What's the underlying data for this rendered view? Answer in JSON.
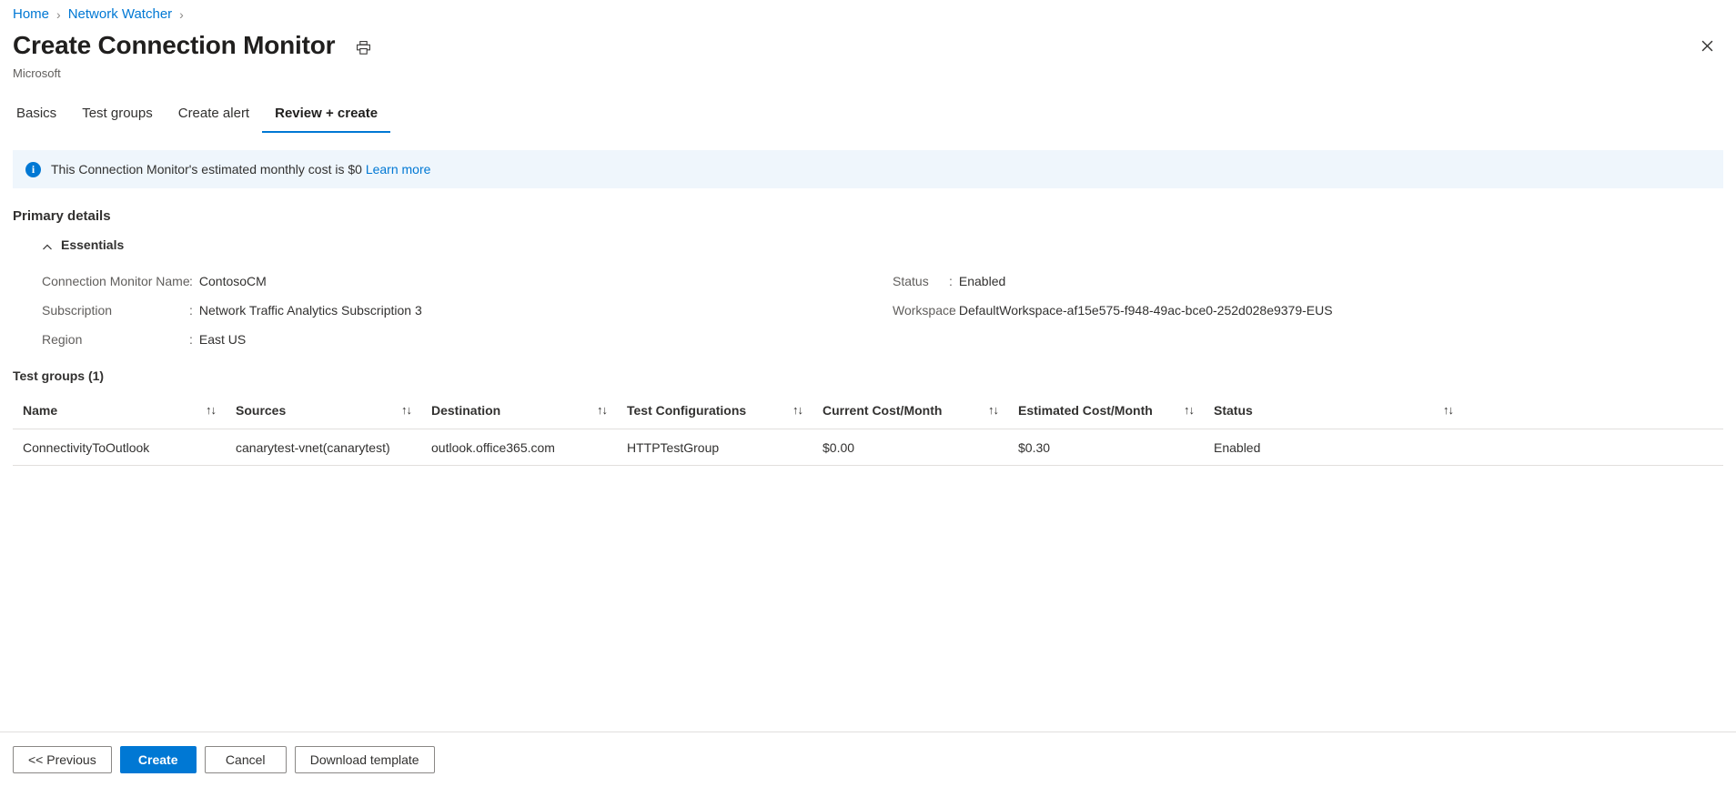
{
  "breadcrumb": {
    "items": [
      {
        "label": "Home"
      },
      {
        "label": "Network Watcher"
      }
    ],
    "separator": "›"
  },
  "header": {
    "title": "Create Connection Monitor",
    "subtitle": "Microsoft",
    "print_icon": "print-icon",
    "close_icon": "close-icon",
    "close_glyph": "✕"
  },
  "tabs": [
    {
      "label": "Basics",
      "active": false
    },
    {
      "label": "Test groups",
      "active": false
    },
    {
      "label": "Create alert",
      "active": false
    },
    {
      "label": "Review + create",
      "active": true
    }
  ],
  "banner": {
    "icon": "info-icon",
    "icon_glyph": "i",
    "text": "This Connection Monitor's estimated monthly cost is $0",
    "link_label": "Learn more",
    "background_color": "#eff6fc",
    "accent_color": "#0078d4"
  },
  "primary_details": {
    "section_title": "Primary details",
    "essentials_label": "Essentials",
    "essentials_expanded": true,
    "left_fields": [
      {
        "key": "Connection Monitor Name",
        "value": "ContosoCM"
      },
      {
        "key": "Subscription",
        "value": "Network Traffic Analytics Subscription 3"
      },
      {
        "key": "Region",
        "value": "East US"
      }
    ],
    "right_fields": [
      {
        "key": "Status",
        "value": "Enabled"
      },
      {
        "key": "Workspace",
        "value": "DefaultWorkspace-af15e575-f948-49ac-bce0-252d028e9379-EUS"
      }
    ],
    "colon": ":"
  },
  "test_groups": {
    "title": "Test groups (1)",
    "sort_glyph": "↑↓",
    "columns": [
      "Name",
      "Sources",
      "Destination",
      "Test Configurations",
      "Current Cost/Month",
      "Estimated Cost/Month",
      "Status"
    ],
    "rows": [
      {
        "name": "ConnectivityToOutlook",
        "sources": "canarytest-vnet(canarytest)",
        "destination": "outlook.office365.com",
        "test_configurations": "HTTPTestGroup",
        "current_cost_month": "$0.00",
        "estimated_cost_month": "$0.30",
        "status": "Enabled"
      }
    ]
  },
  "footer": {
    "previous_label": "<< Previous",
    "create_label": "Create",
    "cancel_label": "Cancel",
    "download_label": "Download template",
    "primary_color": "#0078d4"
  }
}
